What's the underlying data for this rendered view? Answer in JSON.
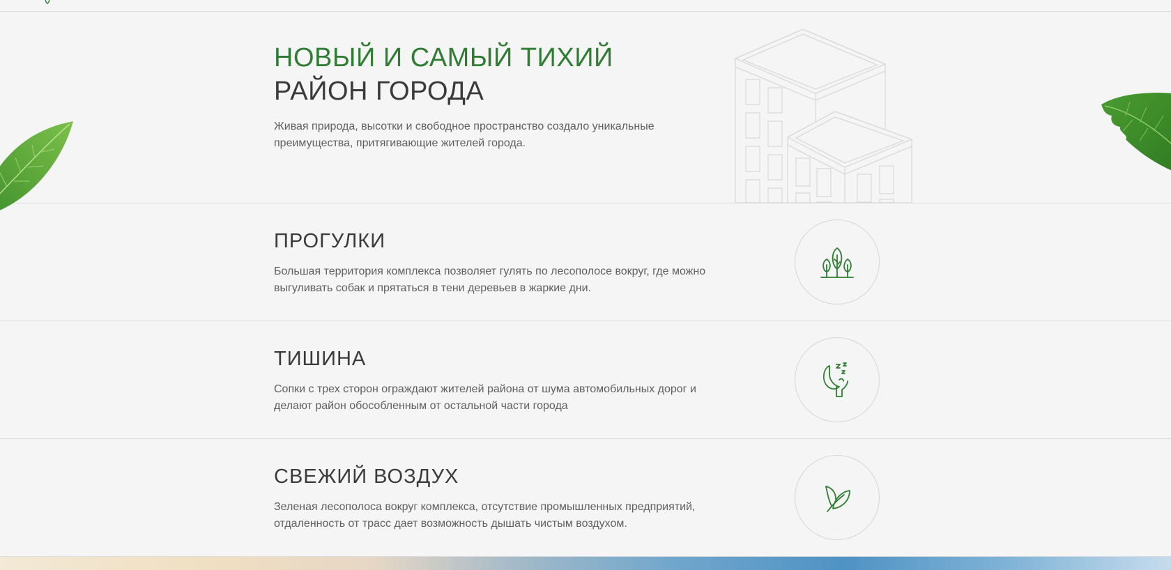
{
  "hero": {
    "title_line1": "НОВЫЙ И САМЫЙ ТИХИЙ",
    "title_line2": "РАЙОН ГОРОДА",
    "text": "Живая природа, высотки и свободное пространство создало уникальные преимущества, притягивающие жителей города."
  },
  "features": [
    {
      "title": "ПРОГУЛКИ",
      "text": "Большая территория комплекса позволяет гулять по лесополосе вокруг, где можно выгуливать собак и прятаться в тени деревьев в жаркие дни.",
      "icon": "trees-icon"
    },
    {
      "title": "ТИШИНА",
      "text": "Сопки с трех сторон ограждают жителей района от шума автомобильных дорог и делают район обособленным от остальной части города",
      "icon": "sleep-moon-icon"
    },
    {
      "title": "СВЕЖИЙ ВОЗДУХ",
      "text": "Зеленая лесополоса вокруг комплекса, отсутствие промышленных предприятий, отдаленность от трасс дает возможность дышать чистым воздухом.",
      "icon": "leaf-icon"
    }
  ],
  "colors": {
    "accent_green": "#2e7d32",
    "background": "#f5f5f5",
    "heading_dark": "#3a3a3a",
    "body_text": "#5f5f5f",
    "divider": "#dcdcdc"
  }
}
